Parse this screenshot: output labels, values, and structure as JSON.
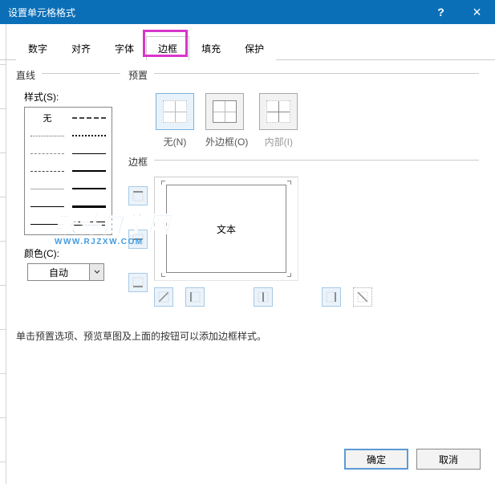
{
  "dialog": {
    "title": "设置单元格格式",
    "help": "?",
    "close": "×"
  },
  "tabs": [
    "数字",
    "对齐",
    "字体",
    "边框",
    "填充",
    "保护"
  ],
  "active_tab": "边框",
  "line_group": "直线",
  "style_label": "样式(S):",
  "style_none": "无",
  "color_label": "颜色(C):",
  "color_value": "自动",
  "preset_group": "预置",
  "presets": {
    "none": "无(N)",
    "outline": "外边框(O)",
    "inside": "内部(I)"
  },
  "border_group": "边框",
  "preview_text": "文本",
  "instruction": "单击预置选项、预览草图及上面的按钮可以添加边框样式。",
  "buttons": {
    "ok": "确定",
    "cancel": "取消"
  },
  "watermark": {
    "text": "软件自学网",
    "url": "WWW.RJZXW.COM"
  }
}
